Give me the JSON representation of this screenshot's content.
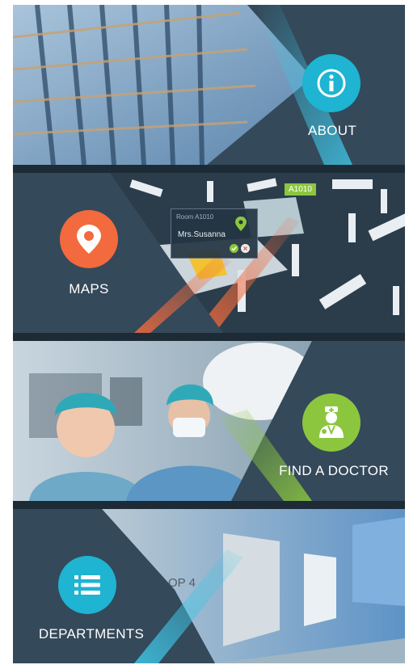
{
  "tiles": {
    "about": {
      "label": "ABOUT",
      "icon": "info-icon",
      "color": "#1eb4d2"
    },
    "maps": {
      "label": "MAPS",
      "icon": "map-pin-icon",
      "color": "#f26a3d",
      "card": {
        "room": "Room A1010",
        "name": "Mrs.Susanna"
      },
      "tag": "A1010"
    },
    "find_doctor": {
      "label": "FIND A DOCTOR",
      "icon": "doctor-icon",
      "color": "#8cc63f"
    },
    "departments": {
      "label": "DEPARTMENTS",
      "icon": "list-icon",
      "color": "#1eb4d2",
      "door_sign": "OP 4"
    }
  },
  "colors": {
    "panel": "#34495a",
    "divider": "#1d2b36"
  }
}
